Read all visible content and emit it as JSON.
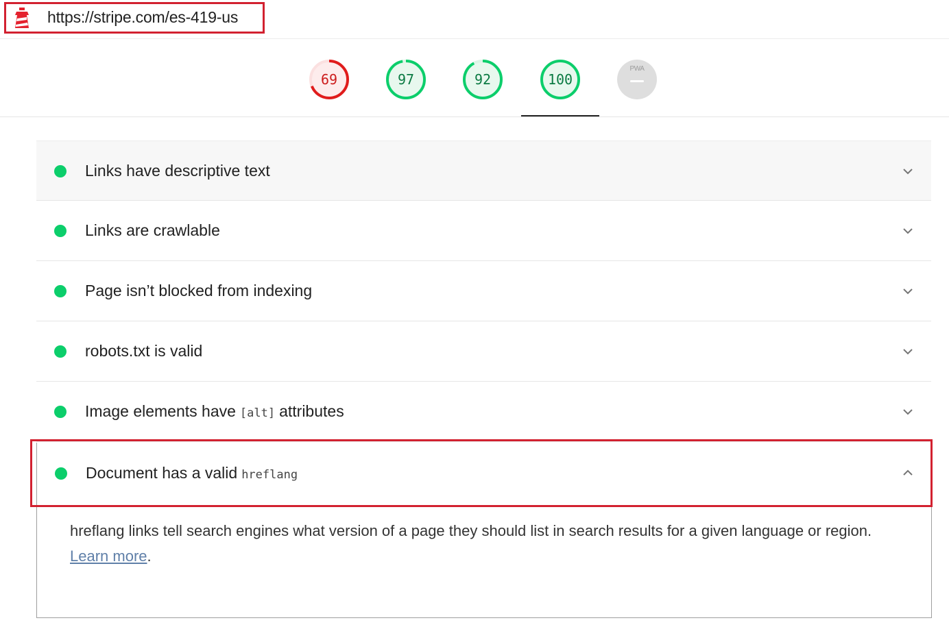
{
  "url_bar": {
    "url": "https://stripe.com/es-419-us",
    "logo_icon": "lighthouse-icon",
    "highlight_color": "#d22130"
  },
  "scores": [
    {
      "category": "performance",
      "value": "69",
      "fraction": 0.69,
      "color": "#e01c1c"
    },
    {
      "category": "accessibility",
      "value": "97",
      "fraction": 0.97,
      "color": "#0cce6b"
    },
    {
      "category": "best-practices",
      "value": "92",
      "fraction": 0.92,
      "color": "#0cce6b"
    },
    {
      "category": "seo",
      "value": "100",
      "fraction": 1.0,
      "color": "#0cce6b",
      "active": true
    },
    {
      "category": "pwa",
      "label": "PWA",
      "value": "—"
    }
  ],
  "audits": [
    {
      "title": "Links have descriptive text",
      "status": "pass"
    },
    {
      "title": "Links are crawlable",
      "status": "pass"
    },
    {
      "title": "Page isn’t blocked from indexing",
      "status": "pass"
    },
    {
      "title": "robots.txt is valid",
      "status": "pass"
    },
    {
      "title_before": "Image elements have",
      "code": "[alt]",
      "title_after": "attributes",
      "status": "pass"
    }
  ],
  "expanded_audit": {
    "title": "Document has a valid",
    "code": "hreflang",
    "status": "pass",
    "description": "hreflang links tell search engines what version of a page they should list in search results for a given language or region.",
    "learn_more": "Learn more",
    "trailing": "."
  },
  "colors": {
    "pass": "#0cce6b",
    "fail": "#e01c1c",
    "highlight": "#d22130"
  }
}
